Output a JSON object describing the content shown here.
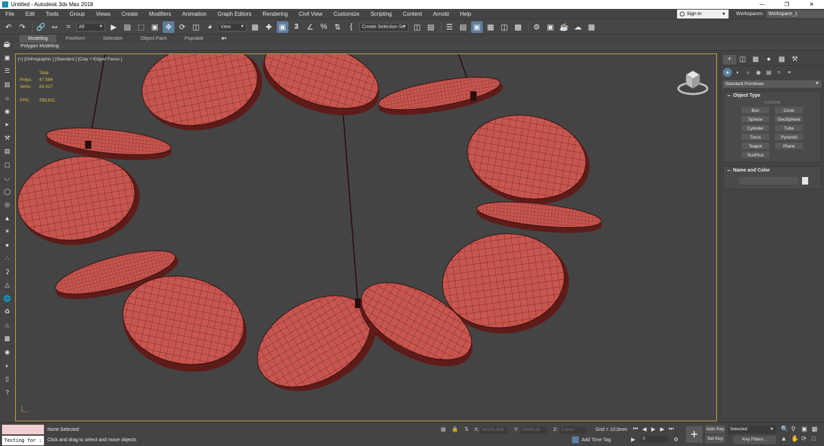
{
  "window": {
    "title": "Untitled - Autodesk 3ds Max 2018",
    "controls": [
      "—",
      "❒",
      "✕"
    ]
  },
  "menu": [
    "File",
    "Edit",
    "Tools",
    "Group",
    "Views",
    "Create",
    "Modifiers",
    "Animation",
    "Graph Editors",
    "Rendering",
    "Civil View",
    "Customize",
    "Scripting",
    "Content",
    "Arnold",
    "Help"
  ],
  "account": {
    "sign_in": "Sign In",
    "workspaces_label": "Workspaces:",
    "workspace_value": "Workspace_1"
  },
  "toolbar": {
    "filter_value": "All",
    "coord_system": "View",
    "snap_number": "3",
    "selection_set_placeholder": "Create Selection Se"
  },
  "ribbon": {
    "tabs": [
      "Modeling",
      "Freeform",
      "Selection",
      "Object Paint",
      "Populate",
      "■▾"
    ],
    "panel_label": "Polygon Modeling"
  },
  "viewport": {
    "label": "[+] [Orthographic ] [Standard ] [Clay + Edged Faces ]",
    "stats": {
      "total_label": "Total",
      "polys_label": "Polys:",
      "polys_value": "47 584",
      "verts_label": "Verts:",
      "verts_value": "24 327",
      "fps_label": "FPS:",
      "fps_value": "299,931"
    },
    "object_color": "#c8564f",
    "background": "#444444"
  },
  "command_panel": {
    "category_dropdown": "Standard Primitives",
    "object_type": {
      "header": "Object Type",
      "autogrid": "AutoGrid",
      "buttons": [
        "Box",
        "Cone",
        "Sphere",
        "GeoSphere",
        "Cylinder",
        "Tube",
        "Torus",
        "Pyramid",
        "Teapot",
        "Plane",
        "TextPlus"
      ]
    },
    "name_and_color": {
      "header": "Name and Color"
    }
  },
  "status": {
    "script_input": "Testing for :",
    "selection": "None Selected",
    "prompt": "Click and drag to select and move objects",
    "x_label": "X:",
    "x_value": "92335,906",
    "y_label": "Y:",
    "y_value": "20940,45",
    "z_label": "Z:",
    "z_value": "0,0mm",
    "grid": "Grid = 10,0mm",
    "add_time_tag": "Add Time Tag",
    "frame": "0",
    "auto_key": "Auto Key",
    "set_key": "Set Key",
    "key_mode": "Selected",
    "key_filters": "Key Filters..."
  }
}
